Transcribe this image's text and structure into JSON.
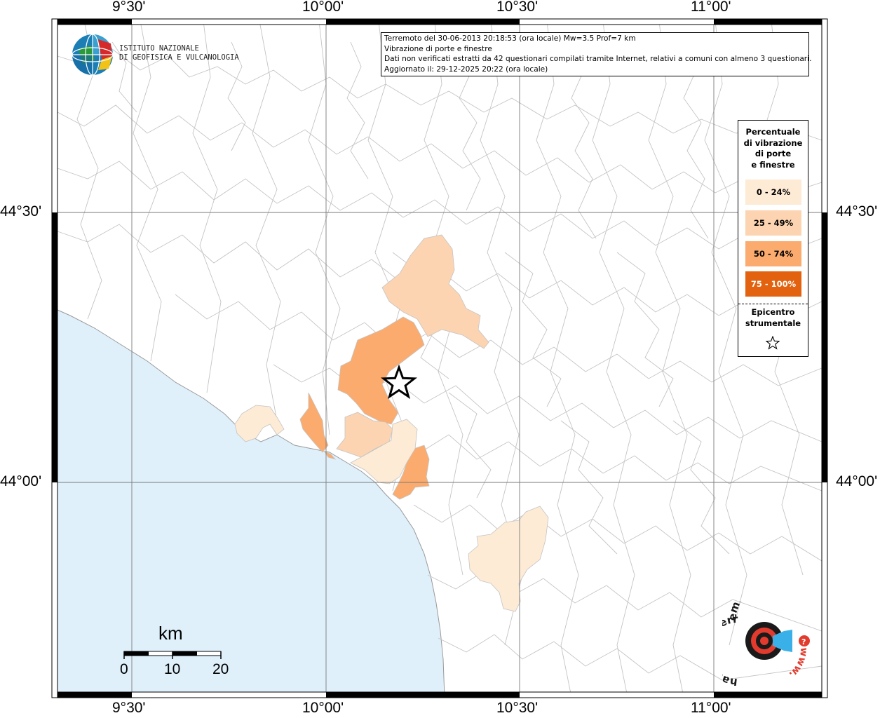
{
  "info": {
    "line1": "Terremoto del 30-06-2013 20:18:53 (ora locale) Mw=3.5 Prof=7 km",
    "line2": "Vibrazione di porte e finestre",
    "line3": "Dati non verificati estratti da 42 questionari compilati tramite Internet, relativi a comuni con almeno 3 questionari.",
    "line4": "Aggiornato il: 29-12-2025 20:22 (ora locale)"
  },
  "axes": {
    "lon_top": [
      "9°30'",
      "10°00'",
      "10°30'",
      "11°00'"
    ],
    "lon_bottom": [
      "9°30'",
      "10°00'",
      "10°30'",
      "11°00'"
    ],
    "lat_left": [
      "44°30'",
      "44°00'"
    ],
    "lat_right": [
      "44°30'",
      "44°00'"
    ]
  },
  "legend": {
    "title_lines": [
      "Percentuale",
      "di vibrazione",
      "di porte",
      "e finestre"
    ],
    "classes": [
      {
        "label": "0 - 24%",
        "color": "#fdebd6"
      },
      {
        "label": "25 - 49%",
        "color": "#fcd4b1"
      },
      {
        "label": "50 - 74%",
        "color": "#fbab6d"
      },
      {
        "label": "75 - 100%",
        "color": "#e2620f"
      }
    ],
    "epicenter_lines": [
      "Epicentro",
      "strumentale"
    ]
  },
  "logo": {
    "line1": "ISTITUTO NAZIONALE",
    "line2": "DI GEOFISICA E VULCANOLOGIA"
  },
  "scale": {
    "unit": "km",
    "ticks": [
      "0",
      "10",
      "20"
    ]
  },
  "hsi_logo": {
    "text": "haisentitoilterremoto.it",
    "www": "www."
  },
  "colors": {
    "sea": "#dff0fb",
    "boundary": "#b8b8b8",
    "grid": "#7a7a7a",
    "epicenter": "#000000"
  }
}
